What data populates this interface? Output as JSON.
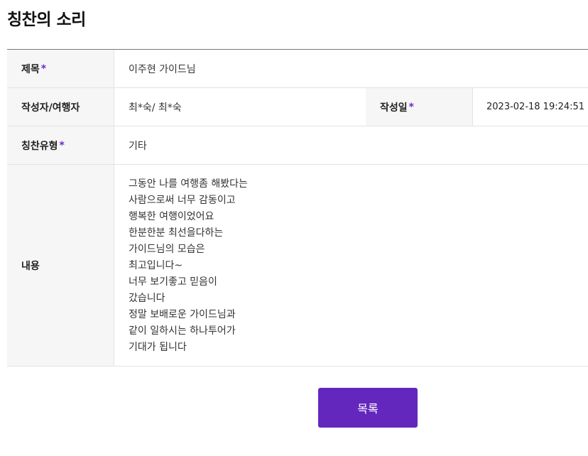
{
  "page": {
    "title": "칭찬의 소리"
  },
  "form": {
    "subject": {
      "label": "제목",
      "required_mark": "*",
      "value": "이주현 가이드님"
    },
    "writer": {
      "label": "작성자/여행자",
      "value": "최*숙/ 최*숙"
    },
    "date": {
      "label": "작성일",
      "required_mark": "*",
      "value": "2023-02-18 19:24:51"
    },
    "praise_type": {
      "label": "칭찬유형",
      "required_mark": "*",
      "value": "기타"
    },
    "content": {
      "label": "내용",
      "lines": [
        "그동안 나를 여행좀 해봤다는",
        "사람으로써 너무 감동이고",
        "행복한 여행이었어요",
        "한분한분 최선을다하는",
        "가이드님의 모습은",
        "최고입니다~",
        "너무 보기좋고 믿음이",
        "갔습니다",
        "정말 보배로운 가이드님과",
        "같이 일하시는 하나투어가",
        "기대가 됩니다"
      ]
    }
  },
  "actions": {
    "list_button_label": "목록"
  },
  "colors": {
    "accent": "#6427bd",
    "required_mark": "#6a2cc8",
    "header_cell_bg": "#f6f6f6"
  }
}
